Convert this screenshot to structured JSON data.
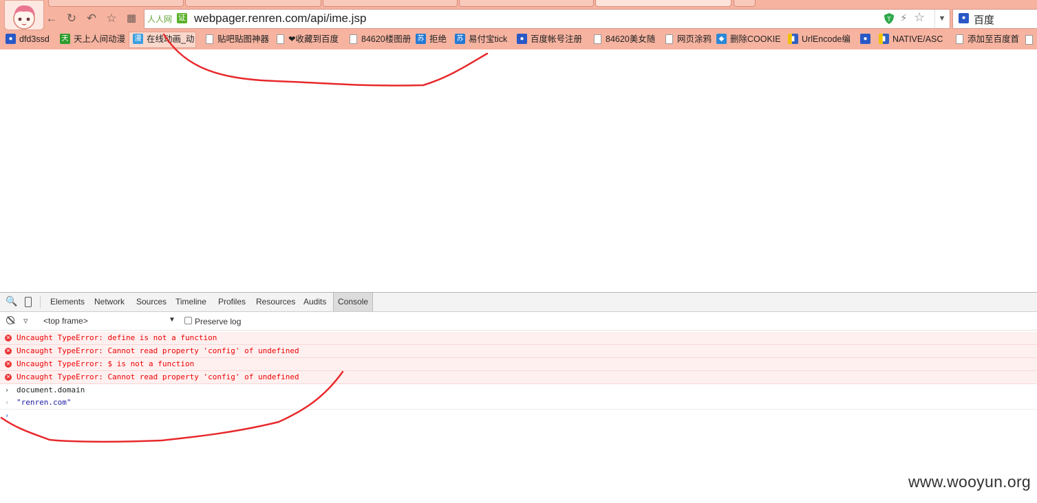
{
  "browser": {
    "omnibox": {
      "site_label": "人人网",
      "cert_badge": "证",
      "url": "webpager.renren.com/api/ime.jsp"
    },
    "search_engine": "百度",
    "bookmarks": [
      {
        "label": "dfd3ssd",
        "icon": "baidu-paw-icon"
      },
      {
        "label": "天上人间动漫",
        "icon": "tian-icon"
      },
      {
        "label": "在线动画_动",
        "icon": "man-icon"
      },
      {
        "label": "贴吧贴图神器",
        "icon": "file-icon"
      },
      {
        "label": "❤收藏到百度",
        "icon": "file-icon"
      },
      {
        "label": "84620楼图册",
        "icon": "file-icon"
      },
      {
        "label": "拒绝",
        "icon": "su-icon"
      },
      {
        "label": "易付宝tick",
        "icon": "su-icon"
      },
      {
        "label": "百度帐号注册",
        "icon": "baidu-paw-icon"
      },
      {
        "label": "84620美女随",
        "icon": "file-icon"
      },
      {
        "label": "网页涂鸦",
        "icon": "file-icon"
      },
      {
        "label": "删除COOKIE",
        "icon": "shield-icon"
      },
      {
        "label": "UrlEncode编",
        "icon": "colorbar-icon"
      },
      {
        "label": "",
        "icon": "baidu-paw-icon"
      },
      {
        "label": "NATIVE/ASC",
        "icon": "colorbar-icon"
      },
      {
        "label": "添加至百度首",
        "icon": "file-icon"
      }
    ]
  },
  "devtools": {
    "tabs": [
      "Elements",
      "Network",
      "Sources",
      "Timeline",
      "Profiles",
      "Resources",
      "Audits",
      "Console"
    ],
    "active_tab": "Console",
    "frame_select": "<top frame>",
    "preserve_log_label": "Preserve log",
    "console": {
      "errors": [
        "Uncaught TypeError: define is not a function",
        "Uncaught TypeError: Cannot read property 'config' of undefined",
        "Uncaught TypeError: $ is not a function",
        "Uncaught TypeError: Cannot read property 'config' of undefined"
      ],
      "input": "document.domain",
      "output": "\"renren.com\""
    }
  },
  "watermark": "www.wooyun.org",
  "colors": {
    "chrome_bg": "#f6b3a0",
    "error_text": "#ee0000",
    "annotation": "#e8282b"
  }
}
